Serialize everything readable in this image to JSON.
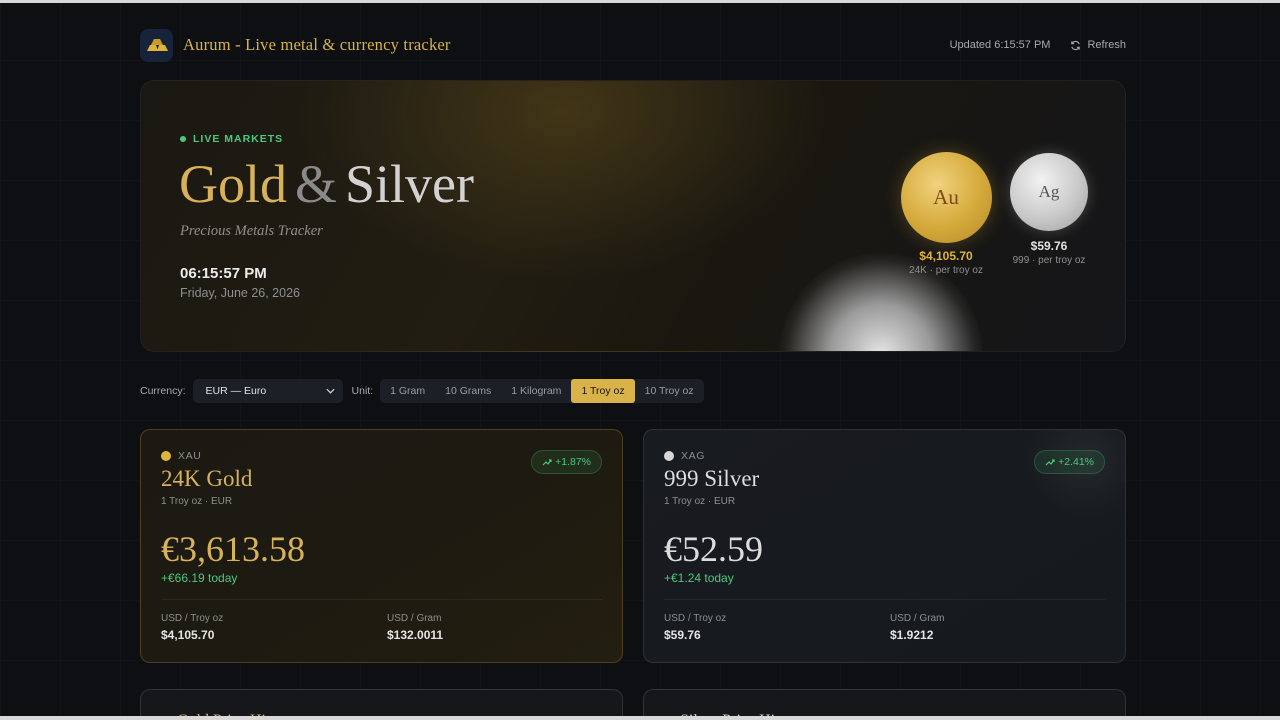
{
  "header": {
    "title": "Aurum - Live metal & currency tracker",
    "updated": "Updated 6:15:57 PM",
    "refresh_label": "Refresh"
  },
  "hero": {
    "live_label": "LIVE MARKETS",
    "title_gold": "Gold",
    "title_amp": "&",
    "title_silver": "Silver",
    "subtitle": "Precious Metals Tracker",
    "time": "06:15:57 PM",
    "date": "Friday, June 26, 2026",
    "coins": [
      {
        "symbol": "Au",
        "price": "$4,105.70",
        "note": "24K · per troy oz"
      },
      {
        "symbol": "Ag",
        "price": "$59.76",
        "note": "999 · per troy oz"
      }
    ]
  },
  "controls": {
    "currency_label": "Currency:",
    "currency_value": "EUR — Euro",
    "unit_label": "Unit:",
    "units": [
      "1 Gram",
      "10 Grams",
      "1 Kilogram",
      "1 Troy oz",
      "10 Troy oz"
    ],
    "active_unit": "1 Troy oz"
  },
  "cards": [
    {
      "symbol": "XAU",
      "name": "24K Gold",
      "meta": "1 Troy oz · EUR",
      "pct": "+1.87%",
      "price": "€3,613.58",
      "change": "+€66.19 today",
      "stats": [
        {
          "label": "USD / Troy oz",
          "value": "$4,105.70"
        },
        {
          "label": "USD / Gram",
          "value": "$132.0011"
        }
      ]
    },
    {
      "symbol": "XAG",
      "name": "999 Silver",
      "meta": "1 Troy oz · EUR",
      "pct": "+2.41%",
      "price": "€52.59",
      "change": "+€1.24 today",
      "stats": [
        {
          "label": "USD / Troy oz",
          "value": "$59.76"
        },
        {
          "label": "USD / Gram",
          "value": "$1.9212"
        }
      ]
    }
  ],
  "bottom_cards": [
    {
      "title": "Gold Price History"
    },
    {
      "title": "Silver Price History"
    }
  ],
  "colors": {
    "accent_gold": "#d9b24a",
    "positive": "#4cc97b",
    "background": "#0d0f12"
  }
}
